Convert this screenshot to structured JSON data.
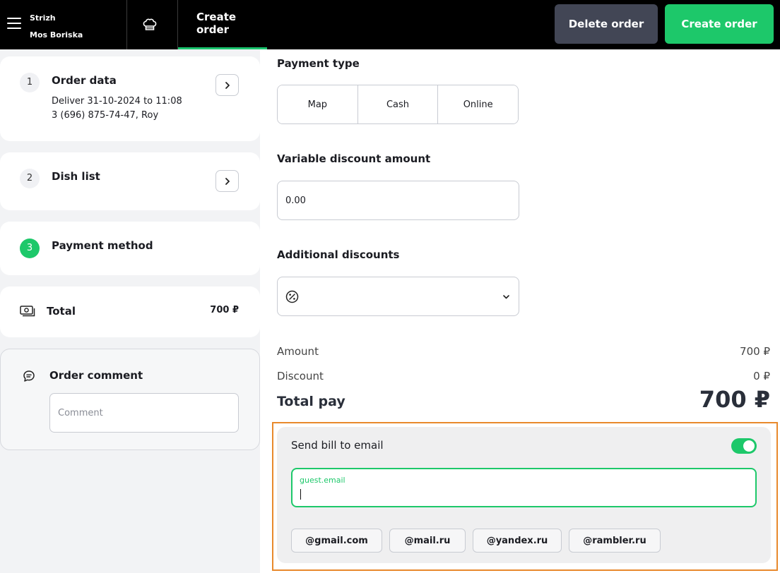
{
  "header": {
    "store_name": "Strizh",
    "store_address": "Mos Boriska",
    "tab_label": "Create order",
    "delete_label": "Delete order",
    "create_label": "Create order"
  },
  "steps": {
    "order_data": {
      "number": "1",
      "title": "Order data",
      "line1": "Deliver 31-10-2024 to 11:08",
      "line2": "3 (696) 875-74-47, Roy"
    },
    "dish_list": {
      "number": "2",
      "title": "Dish list"
    },
    "payment_method": {
      "number": "3",
      "title": "Payment method"
    }
  },
  "total_card": {
    "label": "Total",
    "value": "700 ₽"
  },
  "comment": {
    "title": "Order comment",
    "placeholder": "Comment"
  },
  "payment": {
    "type_label": "Payment type",
    "types": [
      "Map",
      "Cash",
      "Online"
    ],
    "variable_discount_label": "Variable discount amount",
    "variable_discount_value": "0.00",
    "additional_discounts_label": "Additional discounts"
  },
  "summary": {
    "amount_label": "Amount",
    "amount_value": "700 ₽",
    "discount_label": "Discount",
    "discount_value": "0 ₽",
    "total_label": "Total pay",
    "total_value": "700 ₽"
  },
  "email": {
    "label": "Send bill to email",
    "toggle_on": true,
    "field_label": "guest.email",
    "domains": [
      "@gmail.com",
      "@mail.ru",
      "@yandex.ru",
      "@rambler.ru"
    ]
  },
  "colors": {
    "accent": "#1dc86a",
    "highlight": "#e8892c",
    "delete_btn": "#424655"
  }
}
